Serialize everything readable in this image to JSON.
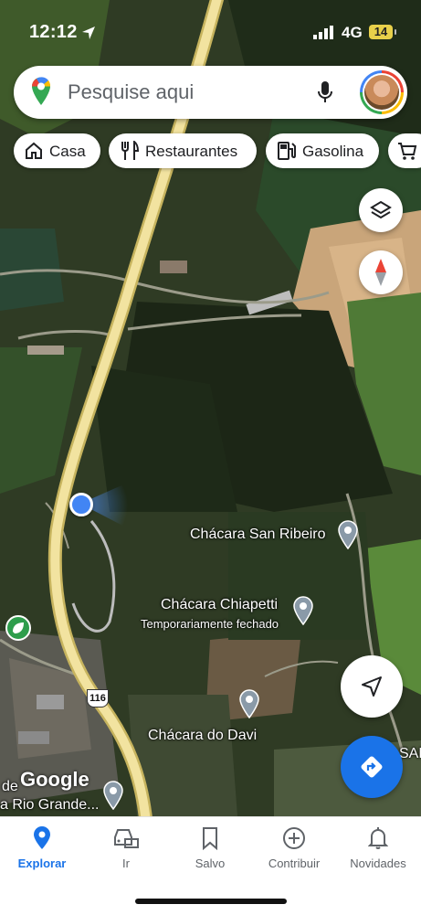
{
  "status_bar": {
    "time": "12:12",
    "network": "4G",
    "battery": "14"
  },
  "search": {
    "placeholder": "Pesquise aqui"
  },
  "chips": [
    {
      "label": "Casa",
      "icon": "home-icon"
    },
    {
      "label": "Restaurantes",
      "icon": "restaurant-icon"
    },
    {
      "label": "Gasolina",
      "icon": "gas-station-icon"
    },
    {
      "label": "",
      "icon": "cart-icon"
    }
  ],
  "map": {
    "road_shield": "116",
    "attribution": "Google",
    "places": [
      {
        "name": "Chácara San Ribeiro"
      },
      {
        "name": "Chácara Chiapetti",
        "status": "Temporariamente fechado"
      },
      {
        "name": "Chácara do Davi"
      }
    ],
    "edge_labels": {
      "left_top": "de",
      "left_bottom": "a Rio Grande...",
      "right": "SAN"
    }
  },
  "nav": [
    {
      "label": "Explorar",
      "icon": "explore-pin-icon",
      "active": true
    },
    {
      "label": "Ir",
      "icon": "car-icon",
      "active": false
    },
    {
      "label": "Salvo",
      "icon": "bookmark-icon",
      "active": false
    },
    {
      "label": "Contribuir",
      "icon": "add-circle-icon",
      "active": false
    },
    {
      "label": "Novidades",
      "icon": "bell-icon",
      "active": false
    }
  ],
  "colors": {
    "accent": "#1a73e8",
    "road": "#f2e3a0",
    "map_green": "#2e3a22"
  }
}
